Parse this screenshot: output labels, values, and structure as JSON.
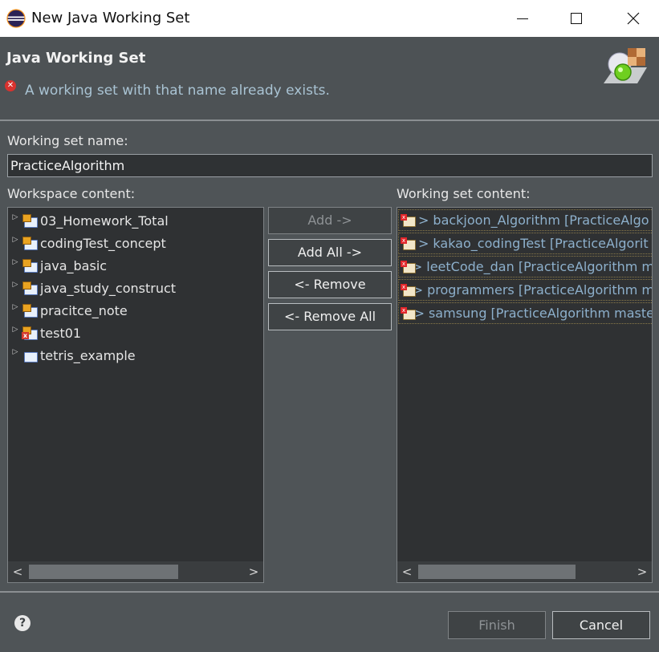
{
  "window": {
    "title": "New Java Working Set"
  },
  "header": {
    "title": "Java Working Set",
    "error_message": "A working set with that name already exists.",
    "error_icon": "error-icon",
    "banner_icon": "working-set-wizard-icon"
  },
  "form": {
    "name_label": "Working set name:",
    "name_value": "PracticeAlgorithm"
  },
  "workspace": {
    "label": "Workspace content:",
    "items": [
      {
        "label": "03_Homework_Total",
        "icon": "java-project-icon"
      },
      {
        "label": "codingTest_concept",
        "icon": "java-project-icon"
      },
      {
        "label": "java_basic",
        "icon": "java-project-icon"
      },
      {
        "label": "java_study_construct",
        "icon": "java-project-icon"
      },
      {
        "label": "pracitce_note",
        "icon": "java-project-icon"
      },
      {
        "label": "test01",
        "icon": "java-project-error-icon"
      },
      {
        "label": "tetris_example",
        "icon": "project-icon"
      }
    ]
  },
  "buttons": {
    "add": "Add ->",
    "add_all": "Add All ->",
    "remove": "<- Remove",
    "remove_all": "<- Remove All"
  },
  "working_set": {
    "label": "Working set content:",
    "items": [
      {
        "label": "backjoon_Algorithm [PracticeAlgo",
        "prefix": ">"
      },
      {
        "label": "kakao_codingTest [PracticeAlgorit",
        "prefix": ">"
      },
      {
        "label": "leetCode_dan [PracticeAlgorithm m",
        "prefix": ">"
      },
      {
        "label": "programmers [PracticeAlgorithm m",
        "prefix": ">"
      },
      {
        "label": "samsung [PracticeAlgorithm maste",
        "prefix": ">"
      }
    ]
  },
  "footer": {
    "finish": "Finish",
    "cancel": "Cancel"
  },
  "colors": {
    "background": "#4f5457",
    "error_text": "#a9c3d3",
    "working_set_text": "#8db0cc"
  }
}
